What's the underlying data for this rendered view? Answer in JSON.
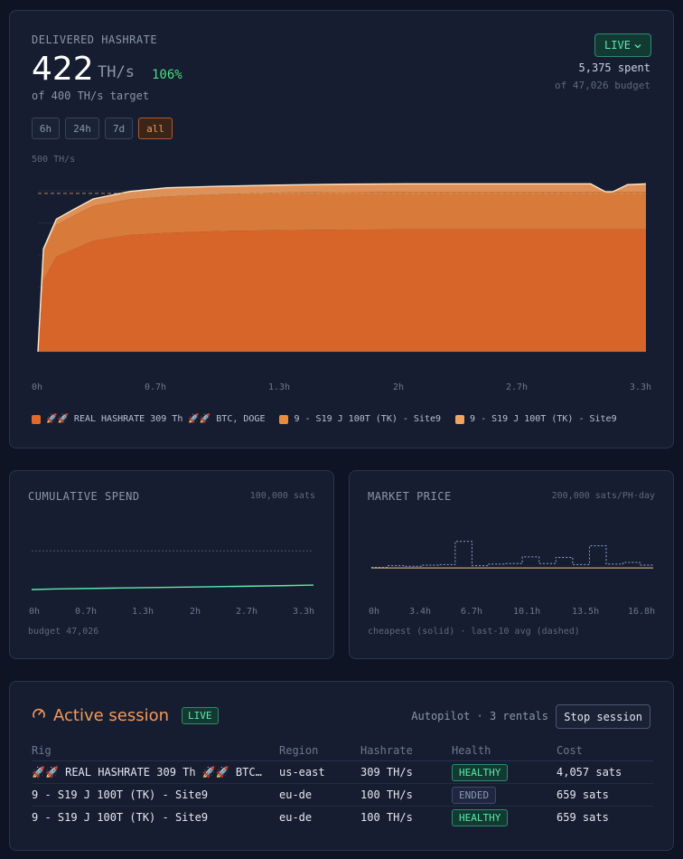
{
  "hashrate": {
    "title": "DELIVERED HASHRATE",
    "value": "422",
    "unit": "TH/s",
    "percent": "106%",
    "target_text": "of 400 TH/s target",
    "live_label": "LIVE",
    "spent_text": "5,375 spent",
    "budget_text": "of 47,026 budget",
    "ranges": [
      "6h",
      "24h",
      "7d",
      "all"
    ],
    "active_range": "all",
    "ymax_label": "500 TH/s",
    "legend": [
      {
        "label": "🚀🚀 REAL HASHRATE 309 Th 🚀🚀 BTC, DOGE",
        "color": "#e2692a"
      },
      {
        "label": "9 - S19 J 100T (TK) - Site9",
        "color": "#ec8a3c"
      },
      {
        "label": "9 - S19 J 100T (TK) - Site9",
        "color": "#f4a35a"
      }
    ]
  },
  "chart_data": [
    {
      "type": "area",
      "title": "DELIVERED HASHRATE",
      "ylim": [
        0,
        500
      ],
      "y_unit": "TH/s",
      "x_ticks": [
        "0h",
        "0.7h",
        "1.3h",
        "2h",
        "2.7h",
        "3.3h"
      ],
      "target": 400,
      "x": [
        0,
        0.03,
        0.1,
        0.2,
        0.3,
        0.5,
        0.7,
        1.0,
        1.3,
        1.6,
        2.0,
        2.4,
        2.7,
        3.0,
        3.08,
        3.12,
        3.2,
        3.3
      ],
      "series": [
        {
          "name": "🚀🚀 REAL HASHRATE 309 Th 🚀🚀 BTC, DOGE",
          "values": [
            0,
            180,
            240,
            260,
            280,
            295,
            300,
            305,
            307,
            308,
            309,
            309,
            309,
            309,
            309,
            309,
            309,
            309
          ]
        },
        {
          "name": "9 - S19 J 100T (TK) - Site9",
          "values": [
            0,
            70,
            80,
            85,
            88,
            90,
            92,
            93,
            95,
            95,
            95,
            95,
            95,
            95,
            95,
            95,
            95,
            95
          ]
        },
        {
          "name": "9 - S19 J 100T (TK) - Site9",
          "values": [
            0,
            10,
            15,
            16,
            18,
            20,
            22,
            20,
            19,
            20,
            20,
            20,
            20,
            20,
            0,
            0,
            18,
            20
          ]
        }
      ]
    },
    {
      "type": "line",
      "title": "CUMULATIVE SPEND",
      "y_max_label": "100,000 sats",
      "x_ticks": [
        "0h",
        "0.7h",
        "1.3h",
        "2h",
        "2.7h",
        "3.3h"
      ],
      "budget": 47026,
      "x": [
        0,
        0.3,
        1,
        2,
        3,
        3.3
      ],
      "values": [
        0,
        800,
        1800,
        3200,
        4800,
        5375
      ]
    },
    {
      "type": "line",
      "title": "MARKET PRICE",
      "y_max_label": "200,000 sats/PH·day",
      "x_ticks": [
        "0h",
        "3.4h",
        "6.7h",
        "10.1h",
        "13.5h",
        "16.8h"
      ],
      "x": [
        0,
        1,
        2,
        3,
        4,
        5,
        6,
        7,
        8,
        9,
        10,
        11,
        12,
        13,
        14,
        15,
        16,
        16.8
      ],
      "series": [
        {
          "name": "cheapest",
          "values": [
            4000,
            4000,
            4000,
            4000,
            4000,
            4000,
            4000,
            4000,
            4000,
            4000,
            4000,
            4000,
            4000,
            4000,
            4000,
            4000,
            4000,
            4000
          ]
        },
        {
          "name": "last-10 avg",
          "values": [
            4500,
            6000,
            5500,
            6500,
            7000,
            28000,
            6000,
            7500,
            8000,
            14000,
            8000,
            13500,
            7000,
            24000,
            7500,
            9000,
            6500,
            5500
          ]
        }
      ]
    }
  ],
  "spend": {
    "title": "CUMULATIVE SPEND",
    "right_label": "100,000 sats",
    "x_ticks": [
      "0h",
      "0.7h",
      "1.3h",
      "2h",
      "2.7h",
      "3.3h"
    ],
    "footer": "budget 47,026"
  },
  "market": {
    "title": "MARKET PRICE",
    "right_label": "200,000 sats/PH·day",
    "x_ticks": [
      "0h",
      "3.4h",
      "6.7h",
      "10.1h",
      "13.5h",
      "16.8h"
    ],
    "footer": "cheapest (solid) · last-10 avg (dashed)"
  },
  "session": {
    "title": "Active session",
    "live_badge": "LIVE",
    "autopilot_text": "Autopilot · 3 rentals",
    "stop_label": "Stop session",
    "columns": [
      "Rig",
      "Region",
      "Hashrate",
      "Health",
      "Cost"
    ],
    "rows": [
      {
        "rig": "🚀🚀 REAL HASHRATE 309 Th 🚀🚀 BTC…",
        "region": "us-east",
        "hashrate": "309 TH/s",
        "health": "HEALTHY",
        "cost": "4,057 sats"
      },
      {
        "rig": "9 - S19 J 100T (TK) - Site9",
        "region": "eu-de",
        "hashrate": "100 TH/s",
        "health": "ENDED",
        "cost": "659 sats"
      },
      {
        "rig": "9 - S19 J 100T (TK) - Site9",
        "region": "eu-de",
        "hashrate": "100 TH/s",
        "health": "HEALTHY",
        "cost": "659 sats"
      }
    ]
  }
}
